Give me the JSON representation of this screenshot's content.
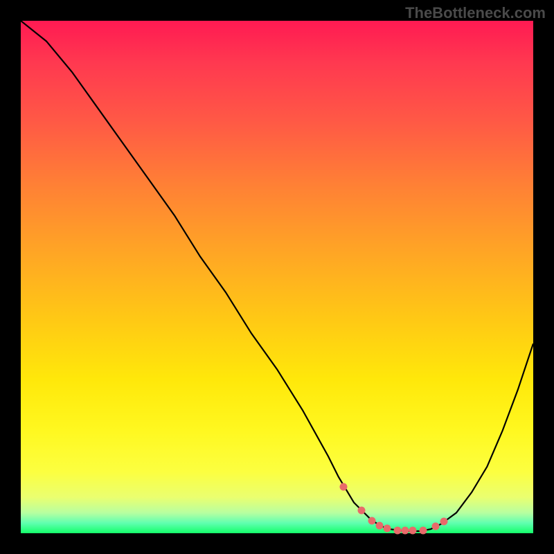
{
  "watermark_text": "TheBottleneck.com",
  "chart_data": {
    "type": "line",
    "title": "",
    "xlabel": "",
    "ylabel": "",
    "xlim": [
      0,
      100
    ],
    "ylim": [
      0,
      100
    ],
    "series": [
      {
        "name": "curve",
        "x": [
          0,
          5,
          10,
          15,
          20,
          25,
          30,
          35,
          40,
          45,
          50,
          55,
          60,
          62,
          65,
          68,
          70,
          72,
          75,
          78,
          80,
          82,
          85,
          88,
          91,
          94,
          97,
          100
        ],
        "values": [
          100,
          96,
          90,
          83,
          76,
          69,
          62,
          54,
          47,
          39,
          32,
          24,
          15,
          11,
          6,
          3,
          1.5,
          0.8,
          0.4,
          0.4,
          0.8,
          1.8,
          4,
          8,
          13,
          20,
          28,
          37
        ]
      }
    ],
    "dots": {
      "name": "highlight-points",
      "x": [
        63,
        66.5,
        68.5,
        70,
        71.5,
        73.5,
        75,
        76.5,
        78.5,
        81,
        82.5
      ],
      "values": [
        9,
        4.5,
        2.5,
        1.5,
        1.0,
        0.6,
        0.5,
        0.5,
        0.6,
        1.3,
        2.3
      ]
    },
    "background_gradient": {
      "top": "#ff1a52",
      "mid": "#ffe80a",
      "bottom": "#14ff6a"
    }
  }
}
